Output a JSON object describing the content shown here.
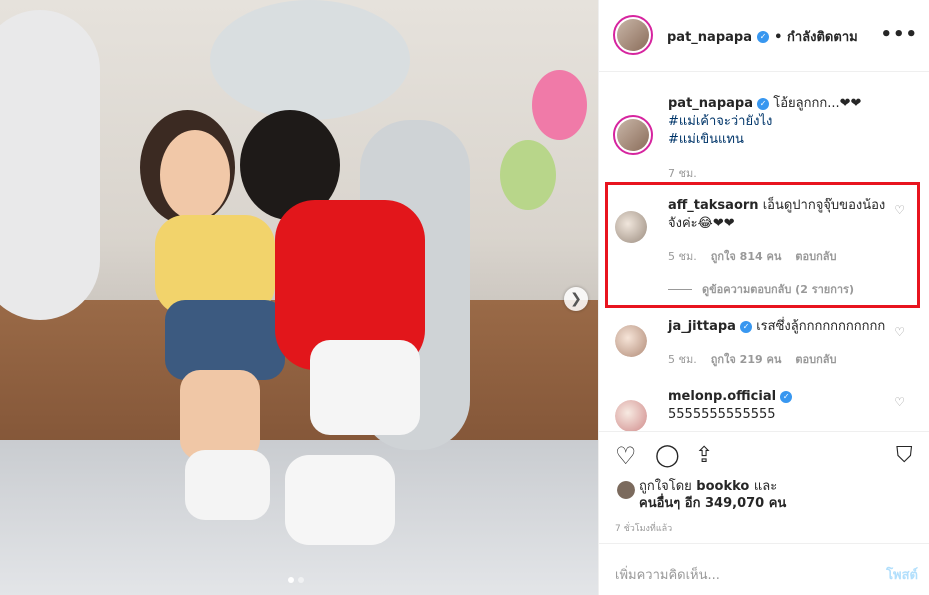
{
  "header": {
    "username": "pat_napapa",
    "following": "• กำลังติดตาม",
    "more": "•••"
  },
  "caption": {
    "username": "pat_napapa",
    "text": "โอ้ยลูกกก...❤❤",
    "hashtags": [
      "#แม่เค้าจะว่ายังไง",
      "#แม่เขินแทน"
    ],
    "time": "7 ชม."
  },
  "comments": [
    {
      "username": "aff_taksaorn",
      "text": "เอ็นดูปากจูจุ๊บของน้องจังค่ะ😂❤❤",
      "time": "5 ชม.",
      "likes": "ถูกใจ 814 คน",
      "reply": "ตอบกลับ",
      "view_replies": "ดูข้อความตอบกลับ (2 รายการ)"
    },
    {
      "username": "ja_jittapa",
      "text": "เรสซึ่งลู้กกกกกกกกกกก",
      "time": "5 ชม.",
      "likes": "ถูกใจ 219 คน",
      "reply": "ตอบกลับ"
    },
    {
      "username": "melonp.official",
      "text": "5555555555555"
    }
  ],
  "liked_by": {
    "prefix": "ถูกใจโดย",
    "user": "bookko",
    "and": "และ",
    "others": "คนอื่นๆ อีก 349,070 คน"
  },
  "time_ago": "7 ชั่วโมงที่แล้ว",
  "add_comment": {
    "placeholder": "เพิ่มความคิดเห็น...",
    "post": "โพสต์"
  },
  "icons": {
    "like": "heart-icon",
    "comment": "comment-icon",
    "share": "share-icon",
    "save": "bookmark-icon"
  },
  "colors": {
    "highlight": "#e8141f",
    "verified": "#3897f0",
    "link": "#003569"
  }
}
